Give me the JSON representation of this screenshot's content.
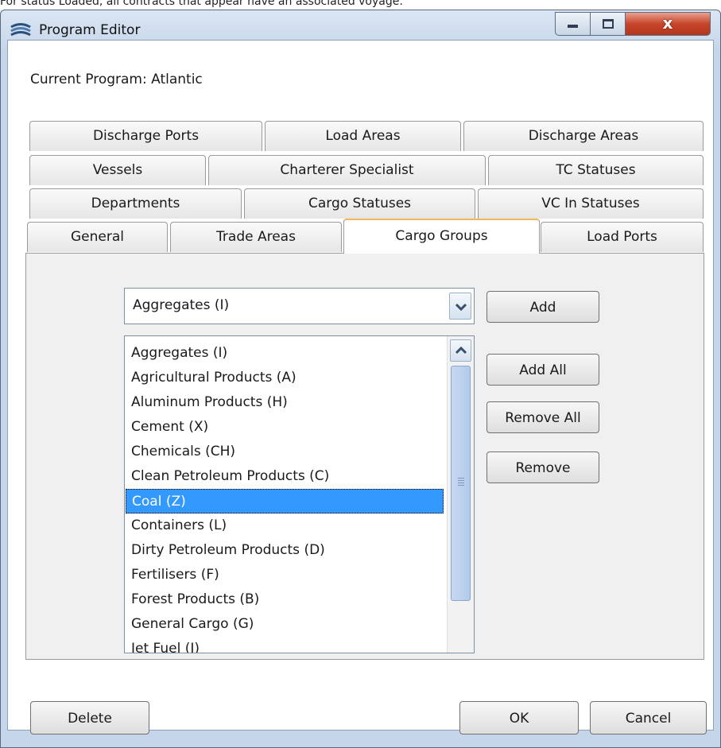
{
  "doc_text": "For status Loaded, all contracts that appear have an associated voyage.",
  "window": {
    "title": "Program Editor",
    "controls": {
      "minimize": "minimize",
      "maximize": "maximize",
      "close": "x"
    }
  },
  "current_program": "Current Program: Atlantic",
  "tabs": {
    "row1": [
      "Discharge Ports",
      "Load Areas",
      "Discharge Areas"
    ],
    "row2": [
      "Vessels",
      "Charterer Specialist",
      "TC Statuses"
    ],
    "row3": [
      "Departments",
      "Cargo Statuses",
      "VC In Statuses"
    ],
    "row4": [
      "General",
      "Trade Areas",
      "Cargo Groups",
      "Load Ports"
    ],
    "active": "Cargo Groups"
  },
  "combo": {
    "value": "Aggregates (I)"
  },
  "buttons": {
    "add": "Add",
    "add_all": "Add All",
    "remove_all": "Remove All",
    "remove": "Remove",
    "delete": "Delete",
    "ok": "OK",
    "cancel": "Cancel"
  },
  "list": {
    "items": [
      "Aggregates (I)",
      "Agricultural Products (A)",
      "Aluminum Products (H)",
      "Cement (X)",
      "Chemicals (CH)",
      "Clean Petroleum Products (C)",
      "Coal (Z)",
      "Containers (L)",
      "Dirty Petroleum Products (D)",
      "Fertilisers (F)",
      "Forest Products (B)",
      "General Cargo (G)",
      "Jet Fuel (J)"
    ],
    "selected": "Coal (Z)"
  },
  "icons": [
    "app-icon",
    "minimize-icon",
    "maximize-icon",
    "close-icon",
    "chevron-down-icon",
    "scroll-up-arrow-icon",
    "scroll-grip-icon"
  ]
}
